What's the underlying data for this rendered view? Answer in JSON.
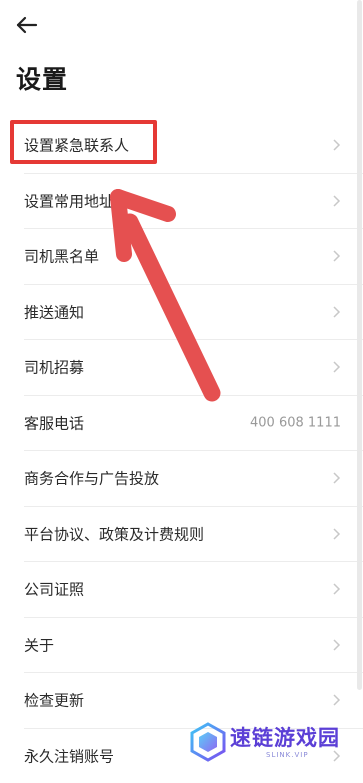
{
  "header": {
    "back_icon": "arrow-left-icon",
    "title": "设置"
  },
  "settings_items": [
    {
      "label": "设置紧急联系人",
      "value": "",
      "chevron": true,
      "highlighted": true
    },
    {
      "label": "设置常用地址",
      "value": "",
      "chevron": true
    },
    {
      "label": "司机黑名单",
      "value": "",
      "chevron": true
    },
    {
      "label": "推送通知",
      "value": "",
      "chevron": true
    },
    {
      "label": "司机招募",
      "value": "",
      "chevron": true
    },
    {
      "label": "客服电话",
      "value": "400 608 1111",
      "chevron": false
    },
    {
      "label": "商务合作与广告投放",
      "value": "",
      "chevron": true
    },
    {
      "label": "平台协议、政策及计费规则",
      "value": "",
      "chevron": true
    },
    {
      "label": "公司证照",
      "value": "",
      "chevron": true
    },
    {
      "label": "关于",
      "value": "",
      "chevron": true
    },
    {
      "label": "检查更新",
      "value": "",
      "chevron": true
    },
    {
      "label": "永久注销账号",
      "value": "",
      "chevron": true
    }
  ],
  "annotation": {
    "highlight_color": "#e53935",
    "arrow_color": "#e53935"
  },
  "watermark": {
    "text": "速链游戏园",
    "sub": "SLINK.VIP",
    "color": "#5b3fd6"
  }
}
